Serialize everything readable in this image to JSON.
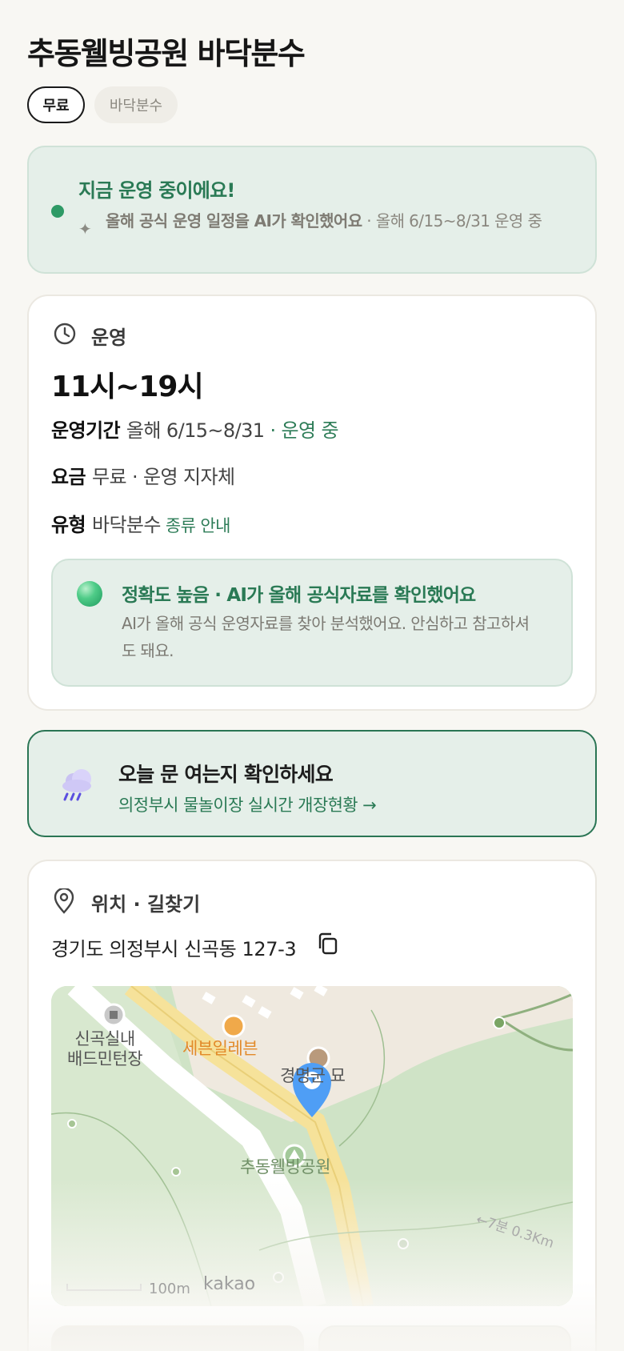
{
  "page": {
    "title": "추동웰빙공원 바닥분수",
    "chips": [
      "무료",
      "바닥분수"
    ]
  },
  "status": {
    "title": "지금 운영 중이에요!",
    "desc_bold": "올해 공식 운영 일정을 AI가 확인했어요",
    "desc_rest": " · 올해 6/15~8/31 운영 중"
  },
  "operation": {
    "heading": "운영",
    "hours": "11시~19시",
    "period_label": "운영기간",
    "period_value": "올해 6/15~8/31",
    "period_status": " · 운영 중",
    "fee_label": "요금",
    "fee_value": "무료 · 운영 지자체",
    "type_label": "유형",
    "type_value": "바닥분수",
    "type_link": "종류 안내"
  },
  "accuracy": {
    "title": "정확도 높음 · AI가 올해 공식자료를 확인했어요",
    "desc": "AI가 올해 공식 운영자료를 찾아 분석했어요. 안심하고 참고하셔도 돼요."
  },
  "realtime": {
    "title": "오늘 문 여는지 확인하세요",
    "link": "의정부시 물놀이장 실시간 개장현황 →",
    "icon": "rain-cloud-icon"
  },
  "location": {
    "heading": "위치 · 길찾기",
    "address": "경기도 의정부시 신곡동 127-3"
  },
  "map": {
    "labels": {
      "badminton": "신곡실내\n배드민턴장",
      "seven_eleven": "세븐일레븐",
      "tomb": "경명군 묘",
      "park": "추동웰빙공원"
    },
    "scale": "100m",
    "brand": "kakao",
    "distance": "←7분 0.3Km"
  },
  "colors": {
    "accent_green": "#2e7d58",
    "status_bg": "#e5efe9",
    "map_road": "#f6e29a",
    "pin": "#4f9ef5"
  }
}
